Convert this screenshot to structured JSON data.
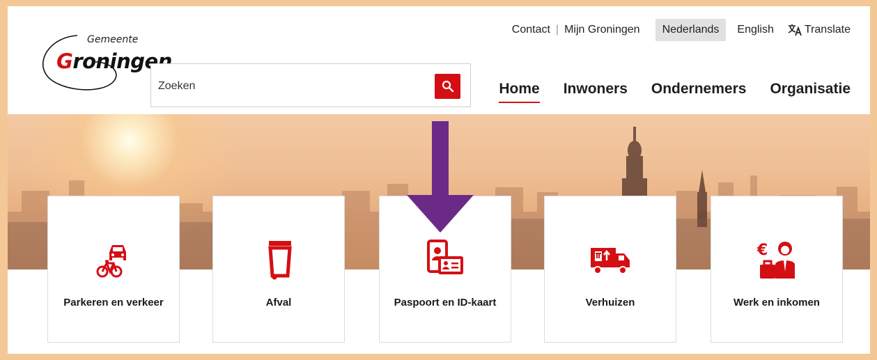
{
  "logo": {
    "sub": "Gemeente",
    "main_first": "G",
    "main_rest": "roningen"
  },
  "topnav": {
    "contact": "Contact",
    "separator": "|",
    "mijn": "Mijn Groningen",
    "lang_nl": "Nederlands",
    "lang_en": "English",
    "translate": "Translate"
  },
  "search": {
    "placeholder": "Zoeken"
  },
  "mainnav": [
    "Home",
    "Inwoners",
    "Ondernemers",
    "Organisatie"
  ],
  "cards": [
    {
      "label": "Parkeren en verkeer",
      "icon": "car-bike-icon"
    },
    {
      "label": "Afval",
      "icon": "trash-bin-icon"
    },
    {
      "label": "Paspoort en ID-kaart",
      "icon": "passport-id-icon"
    },
    {
      "label": "Verhuizen",
      "icon": "moving-truck-icon"
    },
    {
      "label": "Werk en inkomen",
      "icon": "work-income-icon"
    }
  ],
  "colors": {
    "accent": "#d40f14",
    "frame": "#f4c896",
    "arrow": "#6b2a87"
  }
}
